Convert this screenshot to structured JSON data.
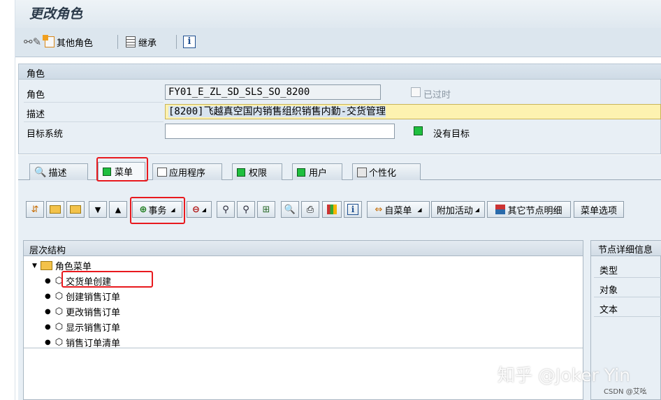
{
  "window": {
    "title": "更改角色"
  },
  "toolbar": {
    "other_role_label": "其他角色",
    "inherit_label": "继承",
    "info_label": "i"
  },
  "header_group": {
    "title": "角色",
    "role_label": "角色",
    "role_value": "FY01_E_ZL_SD_SLS_SO_8200",
    "expired_label": "已过时",
    "desc_label": "描述",
    "desc_value": "[8200]飞越真空国内销售组织销售内勤-交货管理",
    "target_label": "目标系统",
    "target_value": "",
    "no_target_label": "没有目标"
  },
  "tabs": [
    {
      "label": "描述"
    },
    {
      "label": "菜单"
    },
    {
      "label": "应用程序"
    },
    {
      "label": "权限"
    },
    {
      "label": "用户"
    },
    {
      "label": "个性化"
    }
  ],
  "menu_toolbar": {
    "transaction_label": "事务",
    "from_menu_label": "自菜单",
    "additional_activity_label": "附加活动",
    "other_node_details_label": "其它节点明细",
    "menu_options_label": "菜单选项"
  },
  "hierarchy": {
    "header": "层次结构",
    "root": "角色菜单",
    "items": [
      "交货单创建",
      "创建销售订单",
      "更改销售订单",
      "显示销售订单",
      "销售订单清单"
    ]
  },
  "node_details": {
    "header": "节点详细信息",
    "type_label": "类型",
    "object_label": "对象",
    "text_label": "文本"
  },
  "watermark": {
    "main": "知乎 @Joker Yin",
    "small": "CSDN @艾吆"
  },
  "colors": {
    "green_status": "#1fbf3f",
    "highlight_red": "#e8191e",
    "desc_field_bg": "#fdf2b0"
  }
}
